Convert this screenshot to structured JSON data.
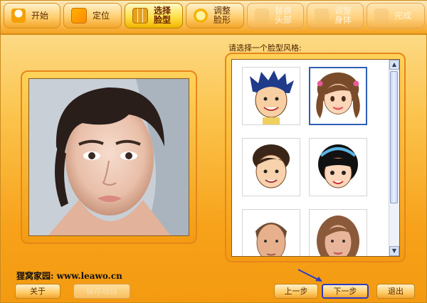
{
  "toolbar": {
    "tabs": [
      {
        "label": "开始",
        "icon": "start-icon",
        "state": "normal"
      },
      {
        "label": "定位",
        "icon": "locate-icon",
        "state": "normal"
      },
      {
        "label": "选择\n脸型",
        "icon": "face-grid-icon",
        "state": "active"
      },
      {
        "label": "调整\n脸形",
        "icon": "adjust-face-icon",
        "state": "normal"
      },
      {
        "label": "替换\n头部",
        "icon": "replace-head-icon",
        "state": "disabled"
      },
      {
        "label": "调整\n身体",
        "icon": "adjust-body-icon",
        "state": "disabled"
      },
      {
        "label": "完成",
        "icon": "finish-icon",
        "state": "disabled"
      }
    ]
  },
  "selector": {
    "prompt": "请选择一个脸型风格:",
    "faces": [
      {
        "name": "cartoon-face-boy-spiky"
      },
      {
        "name": "cartoon-face-girl-pigtails",
        "selected": true
      },
      {
        "name": "cartoon-face-boy-brown"
      },
      {
        "name": "cartoon-face-girl-bangs"
      },
      {
        "name": "cartoon-face-man-realistic"
      },
      {
        "name": "cartoon-face-woman-realistic"
      }
    ]
  },
  "footer": {
    "site": "狸窝家园: www.leawo.cn",
    "about": "关于",
    "save": "保存项目",
    "prev": "上一步",
    "next": "下一步",
    "exit": "退出"
  },
  "colors": {
    "accent": "#f39b12",
    "active_tab": "#ffe14a",
    "selection_border": "#2d5fb5",
    "next_border": "#2f3cc0"
  }
}
